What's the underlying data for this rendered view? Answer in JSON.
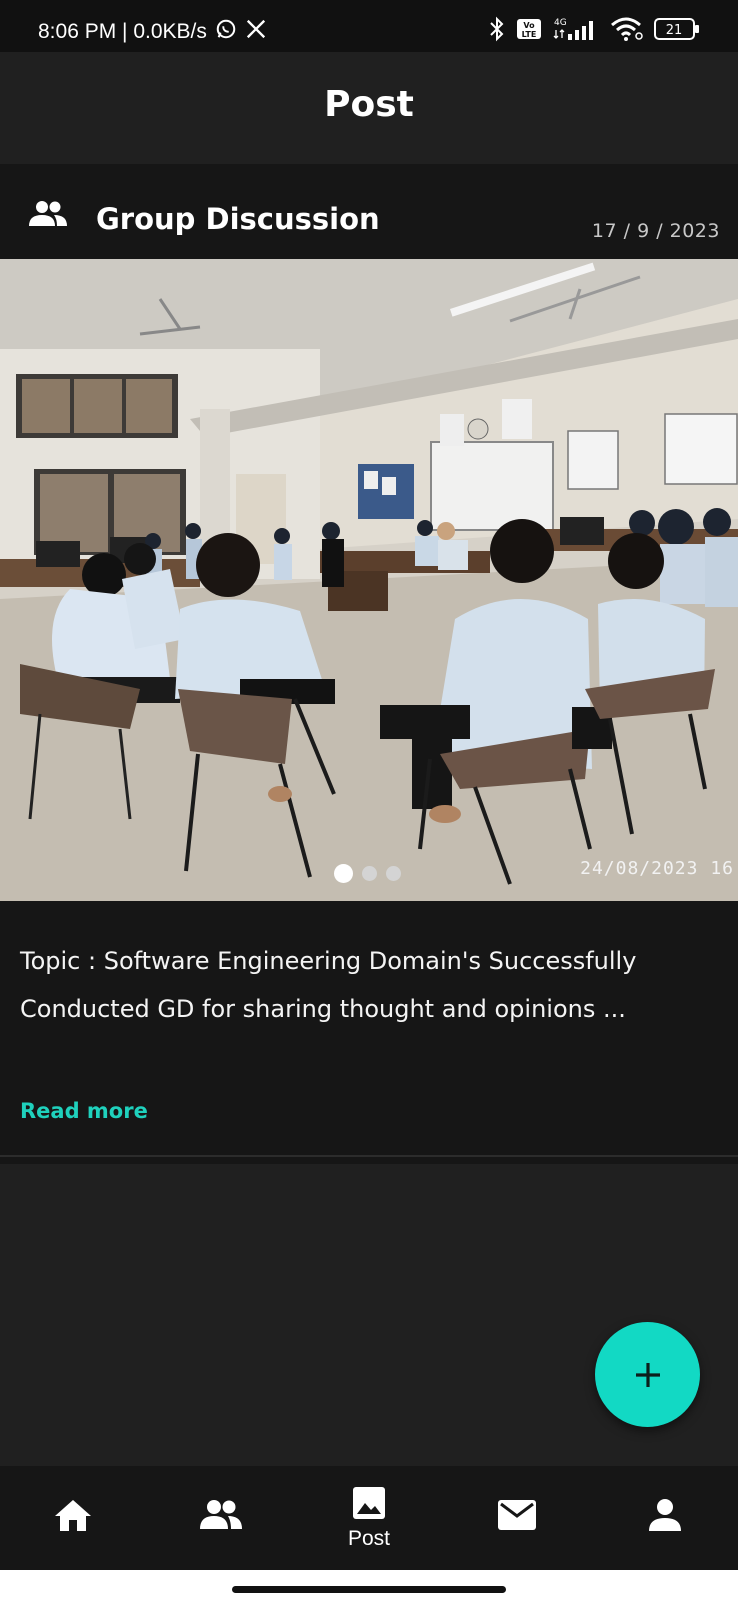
{
  "status_bar": {
    "time_speed": "8:06 PM | 0.0KB/s",
    "network_badge_top": "4G",
    "volte_label": "Vo\nLTE",
    "battery": "21"
  },
  "app_bar": {
    "title": "Post"
  },
  "post": {
    "title": "Group Discussion",
    "date": "17 / 9 / 2023",
    "photo_stamp": "24/08/2023 16",
    "carousel": {
      "count": 3,
      "active_index": 0
    },
    "body": "Topic : Software Engineering Domain's Successfully Conducted GD for sharing thought and opinions ...",
    "read_more": "Read more"
  },
  "fab": {
    "icon": "plus-icon"
  },
  "bottom_nav": {
    "items": [
      {
        "icon": "home-icon",
        "label": ""
      },
      {
        "icon": "group-icon",
        "label": ""
      },
      {
        "icon": "image-icon",
        "label": "Post"
      },
      {
        "icon": "mail-icon",
        "label": ""
      },
      {
        "icon": "person-icon",
        "label": ""
      }
    ]
  },
  "colors": {
    "accent": "#12d9c4",
    "link": "#1fd1bd",
    "background": "#202020",
    "card": "#161616"
  }
}
